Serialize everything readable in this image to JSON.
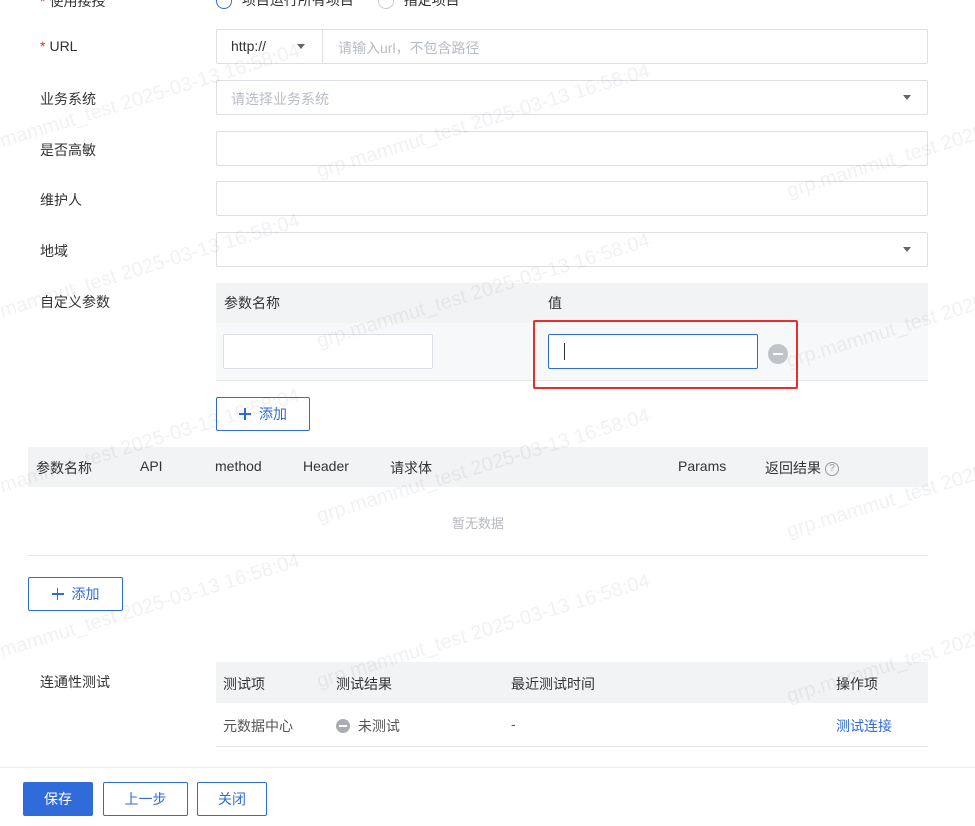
{
  "top_row": {
    "label": "使用接授",
    "option_1": "项目运行所有项目",
    "option_2": "指定项目"
  },
  "url": {
    "label": "URL",
    "protocol": "http://",
    "placeholder": "请输入url，不包含路径"
  },
  "business_system": {
    "label": "业务系统",
    "placeholder": "请选择业务系统"
  },
  "high_sensitive": {
    "label": "是否高敏"
  },
  "maintainer": {
    "label": "维护人"
  },
  "region": {
    "label": "地域"
  },
  "custom_params": {
    "label": "自定义参数",
    "col_name": "参数名称",
    "col_value": "值",
    "add_label": "添加"
  },
  "api_table": {
    "headers": [
      "参数名称",
      "API",
      "method",
      "Header",
      "请求体",
      "Params",
      "返回结果"
    ],
    "empty_text": "暂无数据",
    "add_label": "添加"
  },
  "connectivity": {
    "label": "连通性测试",
    "headers": [
      "测试项",
      "测试结果",
      "最近测试时间",
      "操作项"
    ],
    "rows": [
      {
        "item": "元数据中心",
        "result": "未测试",
        "time": "-",
        "action": "测试连接"
      }
    ]
  },
  "footer": {
    "save": "保存",
    "prev": "上一步",
    "close": "关闭"
  },
  "watermark": "grp.mammut_test 2025-03-13 16:58:04",
  "colors": {
    "primary": "#2f6bd9",
    "required": "#e5302d",
    "highlight_border": "#e5302d"
  }
}
